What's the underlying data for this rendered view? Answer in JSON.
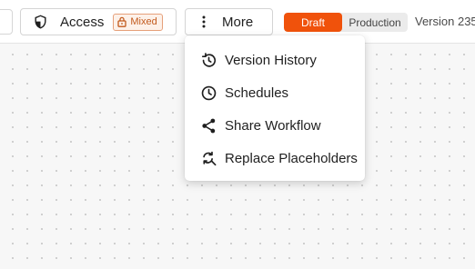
{
  "toolbar": {
    "access": {
      "label": "Access",
      "icon": "shield-icon",
      "badge": {
        "label": "Mixed",
        "icon": "lock-icon"
      }
    },
    "more": {
      "label": "More",
      "icon": "more-vertical-icon"
    },
    "environment": {
      "options": [
        "Draft",
        "Production"
      ],
      "selected": "Draft"
    },
    "version_label": "Version 235"
  },
  "more_menu": {
    "items": [
      {
        "label": "Version History",
        "icon": "history-icon"
      },
      {
        "label": "Schedules",
        "icon": "clock-icon"
      },
      {
        "label": "Share Workflow",
        "icon": "share-icon"
      },
      {
        "label": "Replace Placeholders",
        "icon": "find-replace-icon"
      }
    ]
  },
  "colors": {
    "accent": "#f0520b",
    "badge_text": "#c25a1d",
    "badge_bg": "#fdf1e9"
  }
}
